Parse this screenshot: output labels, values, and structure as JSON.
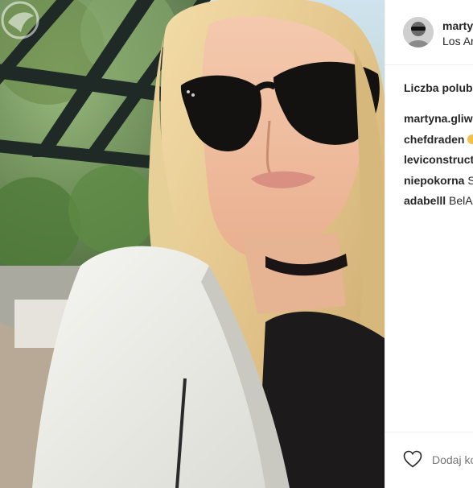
{
  "post": {
    "username": "marty",
    "location": "Los An",
    "likes_label": "Liczba polubi",
    "comments": [
      {
        "author": "martyna.gliw",
        "text": ""
      },
      {
        "author": "chefdraden",
        "text": " ",
        "emoji": true
      },
      {
        "author": "leviconstruct",
        "text": ""
      },
      {
        "author": "niepokorna",
        "text": " S"
      },
      {
        "author": "adabelll",
        "text": " BelA"
      }
    ],
    "add_comment_placeholder": "Dodaj ko"
  },
  "icons": {
    "like": "heart-outline-icon",
    "watermark": "bird-logo-icon"
  },
  "colors": {
    "text": "#262626",
    "muted": "#999999",
    "divider": "#efefef"
  }
}
